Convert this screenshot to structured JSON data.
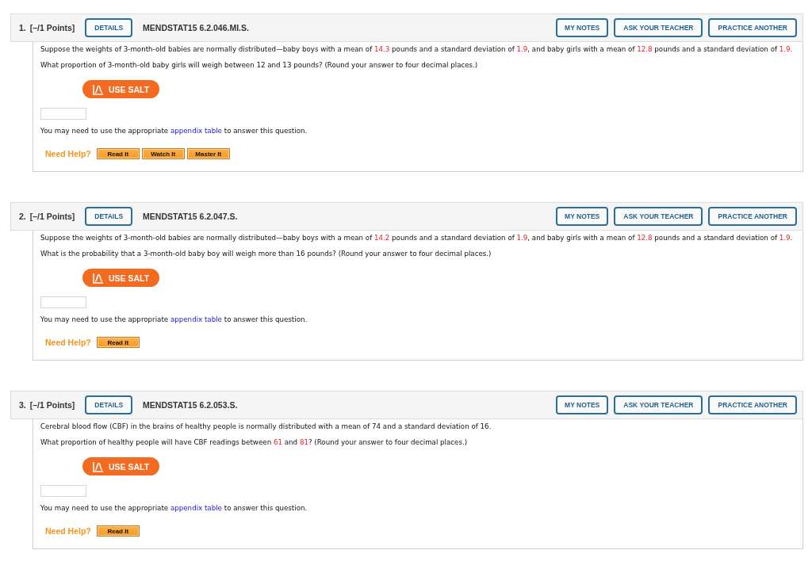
{
  "questions": [
    {
      "number": "1.",
      "points": "[–/1 Points]",
      "details_button": "DETAILS",
      "code": "MENDSTAT15 6.2.046.MI.S.",
      "header_buttons": [
        "MY NOTES",
        "ASK YOUR TEACHER",
        "PRACTICE ANOTHER"
      ],
      "paragraphs": [
        {
          "segments": [
            {
              "text": "Suppose the weights of 3-month-old babies are normally distributed—baby boys with a mean of ",
              "kind": "text"
            },
            {
              "text": "14.3",
              "kind": "value"
            },
            {
              "text": " pounds and a standard deviation of ",
              "kind": "text"
            },
            {
              "text": "1.9",
              "kind": "value"
            },
            {
              "text": ", and baby girls with a mean of ",
              "kind": "text"
            },
            {
              "text": "12.8",
              "kind": "value"
            },
            {
              "text": " pounds and a standard deviation of ",
              "kind": "text"
            },
            {
              "text": "1.9",
              "kind": "value"
            },
            {
              "text": ".",
              "kind": "text"
            }
          ]
        },
        {
          "segments": [
            {
              "text": "What proportion of 3-month-old baby girls will weigh between 12 and 13 pounds? (Round your answer to four decimal places.)",
              "kind": "text"
            }
          ]
        }
      ],
      "salt_button": "USE SALT",
      "appendix_note": {
        "before": "You may need to use the appropriate ",
        "link": "appendix table",
        "after": " to answer this question."
      },
      "need_help": {
        "label": "Need Help?",
        "buttons": [
          "Read It",
          "Watch It",
          "Master It"
        ]
      }
    },
    {
      "number": "2.",
      "points": "[–/1 Points]",
      "details_button": "DETAILS",
      "code": "MENDSTAT15 6.2.047.S.",
      "header_buttons": [
        "MY NOTES",
        "ASK YOUR TEACHER",
        "PRACTICE ANOTHER"
      ],
      "paragraphs": [
        {
          "segments": [
            {
              "text": "Suppose the weights of 3-month-old babies are normally distributed—baby boys with a mean of ",
              "kind": "text"
            },
            {
              "text": "14.2",
              "kind": "value"
            },
            {
              "text": " pounds and a standard deviation of ",
              "kind": "text"
            },
            {
              "text": "1.9",
              "kind": "value"
            },
            {
              "text": ", and baby girls with a mean of ",
              "kind": "text"
            },
            {
              "text": "12.8",
              "kind": "value"
            },
            {
              "text": " pounds and a standard deviation of ",
              "kind": "text"
            },
            {
              "text": "1.9",
              "kind": "value"
            },
            {
              "text": ".",
              "kind": "text"
            }
          ]
        },
        {
          "segments": [
            {
              "text": "What is the probability that a 3-month-old baby boy will weigh more than 16 pounds? (Round your answer to four decimal places.)",
              "kind": "text"
            }
          ]
        }
      ],
      "salt_button": "USE SALT",
      "appendix_note": {
        "before": "You may need to use the appropriate ",
        "link": "appendix table",
        "after": " to answer this question."
      },
      "need_help": {
        "label": "Need Help?",
        "buttons": [
          "Read It"
        ]
      }
    },
    {
      "number": "3.",
      "points": "[–/1 Points]",
      "details_button": "DETAILS",
      "code": "MENDSTAT15 6.2.053.S.",
      "header_buttons": [
        "MY NOTES",
        "ASK YOUR TEACHER",
        "PRACTICE ANOTHER"
      ],
      "paragraphs": [
        {
          "segments": [
            {
              "text": "Cerebral blood flow (CBF) in the brains of healthy people is normally distributed with a mean of 74 and a standard deviation of 16.",
              "kind": "text"
            }
          ]
        },
        {
          "segments": [
            {
              "text": "What proportion of healthy people will have CBF readings between ",
              "kind": "text"
            },
            {
              "text": "61",
              "kind": "value"
            },
            {
              "text": " and ",
              "kind": "text"
            },
            {
              "text": "81",
              "kind": "value"
            },
            {
              "text": "? (Round your answer to four decimal places.)",
              "kind": "text"
            }
          ]
        }
      ],
      "salt_button": "USE SALT",
      "appendix_note": {
        "before": "You may need to use the appropriate ",
        "link": "appendix table",
        "after": " to answer this question."
      },
      "need_help": {
        "label": "Need Help?",
        "buttons": [
          "Read It"
        ]
      }
    }
  ]
}
